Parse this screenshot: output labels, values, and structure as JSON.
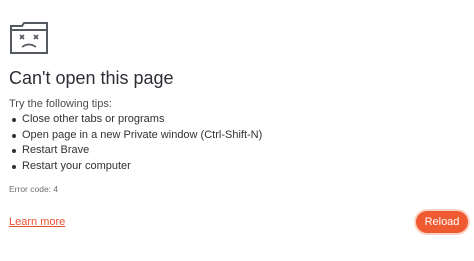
{
  "error_page": {
    "icon": "sad-folder-icon",
    "title": "Can't open this page",
    "tips_heading": "Try the following tips:",
    "tips": [
      "Close other tabs or programs",
      "Open page in a new Private window (Ctrl-Shift-N)",
      "Restart Brave",
      "Restart your computer"
    ],
    "error_code": "Error code: 4",
    "learn_more_label": "Learn more",
    "reload_label": "Reload"
  },
  "colors": {
    "accent": "#f05a30",
    "link": "#e8512f",
    "text": "#2c2f35"
  }
}
